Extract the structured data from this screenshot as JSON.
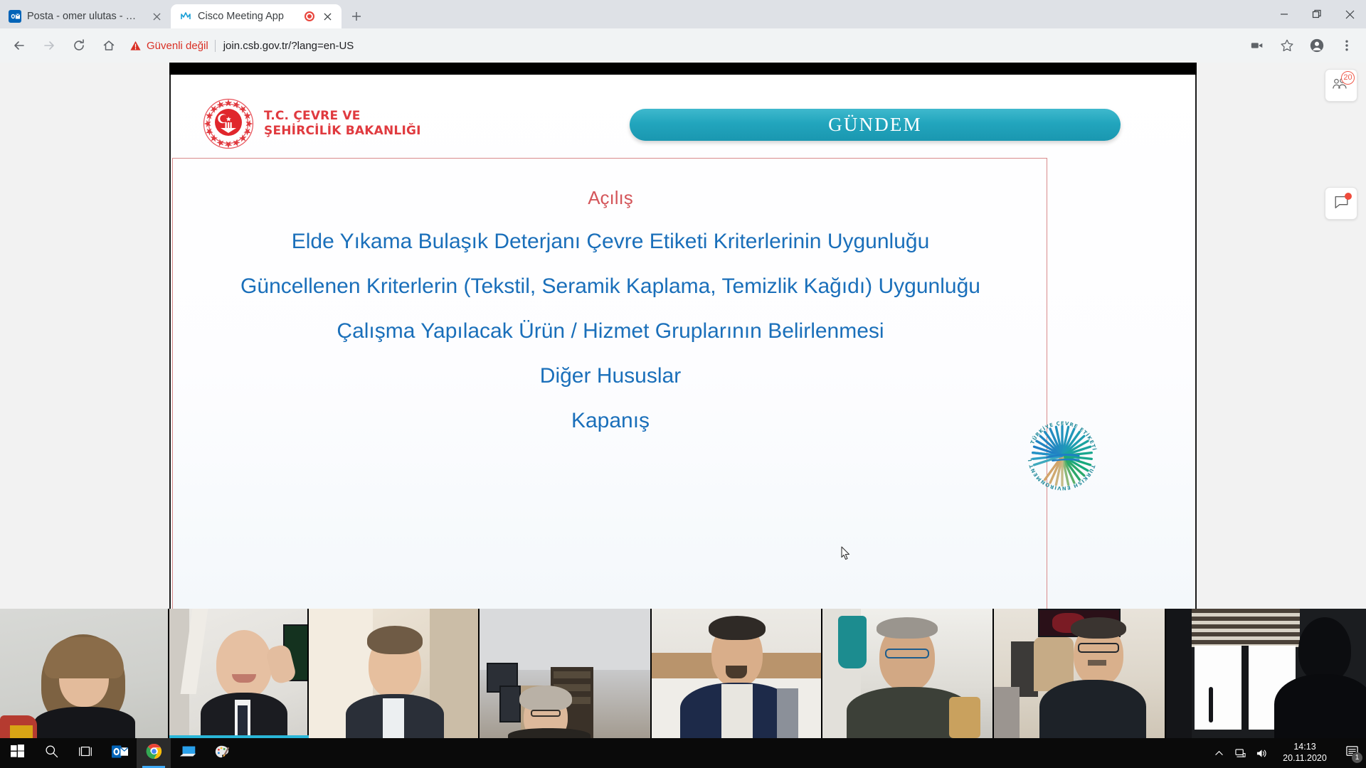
{
  "browser": {
    "tabs": [
      {
        "title": "Posta - omer ulutas - Outlook",
        "favicon": "outlook-icon",
        "active": false,
        "recording": false
      },
      {
        "title": "Cisco Meeting App",
        "favicon": "cisco-meeting-icon",
        "active": true,
        "recording": true
      }
    ],
    "new_tab_label": "+",
    "window_controls": {
      "minimize": "minimize-icon",
      "maximize": "maximize-icon",
      "close": "close-icon"
    },
    "toolbar": {
      "back": "back-arrow-icon",
      "forward": "forward-arrow-icon",
      "reload": "reload-icon",
      "home": "home-icon",
      "security_warning": "Güvenli değil",
      "url": "join.csb.gov.tr/?lang=en-US",
      "media_cast": "video-camera-icon",
      "bookmark": "star-icon",
      "profile": "profile-avatar-icon",
      "menu": "three-dot-menu-icon"
    }
  },
  "slide": {
    "ministry": {
      "seal": "turkish-ministry-seal",
      "name": "T.C. ÇEVRE VE\nŞEHİRCİLİK BAKANLIĞI"
    },
    "banner_title": "GÜNDEM",
    "agenda_items": [
      {
        "text": "Açılış",
        "accent": true
      },
      {
        "text": "Elde Yıkama Bulaşık Deterjanı Çevre Etiketi Kriterlerinin Uygunluğu",
        "accent": false
      },
      {
        "text": "Güncellenen Kriterlerin (Tekstil, Seramik Kaplama, Temizlik Kağıdı) Uygunluğu",
        "accent": false
      },
      {
        "text": "Çalışma Yapılacak Ürün / Hizmet Gruplarının Belirlenmesi",
        "accent": false
      },
      {
        "text": "Diğer Hususlar",
        "accent": false
      },
      {
        "text": "Kapanış",
        "accent": false
      }
    ],
    "ecolabel": {
      "name": "turkish-environment-label-logo",
      "outer_text_top": "TÜRKİYE ÇEVRE ETİKETİ",
      "outer_text_bottom": "TURKISH ENVIRONMENT LABEL"
    },
    "colors": {
      "accent_red": "#d4565b",
      "body_blue": "#1a6fba",
      "banner_teal": "#22a5bd",
      "ministry_red": "#e03a3f"
    }
  },
  "meeting": {
    "participants_badge": "20",
    "participants_icon": "participants-icon",
    "chat_icon": "chat-bubble-icon",
    "chat_unread": true,
    "video_tiles": [
      {
        "label": "participant-1"
      },
      {
        "label": "participant-2",
        "speaking": true
      },
      {
        "label": "participant-3"
      },
      {
        "label": "participant-4"
      },
      {
        "label": "participant-5"
      },
      {
        "label": "participant-6"
      },
      {
        "label": "participant-7"
      },
      {
        "label": "participant-8"
      }
    ]
  },
  "taskbar": {
    "items": [
      {
        "name": "start-button",
        "icon": "windows-logo-icon"
      },
      {
        "name": "search-button",
        "icon": "search-icon"
      },
      {
        "name": "task-view-button",
        "icon": "task-view-icon"
      },
      {
        "name": "outlook-taskbar-item",
        "icon": "outlook-icon"
      },
      {
        "name": "chrome-taskbar-item",
        "icon": "chrome-icon"
      },
      {
        "name": "remote-desktop-taskbar-item",
        "icon": "remote-desktop-icon"
      },
      {
        "name": "paint-taskbar-item",
        "icon": "paint-icon"
      }
    ],
    "tray": {
      "show_hidden": "chevron-up-icon",
      "network": "network-icon",
      "volume": "speaker-icon",
      "time": "14:13",
      "date": "20.11.2020",
      "notification_icon": "action-center-icon",
      "notification_count": "1"
    }
  }
}
